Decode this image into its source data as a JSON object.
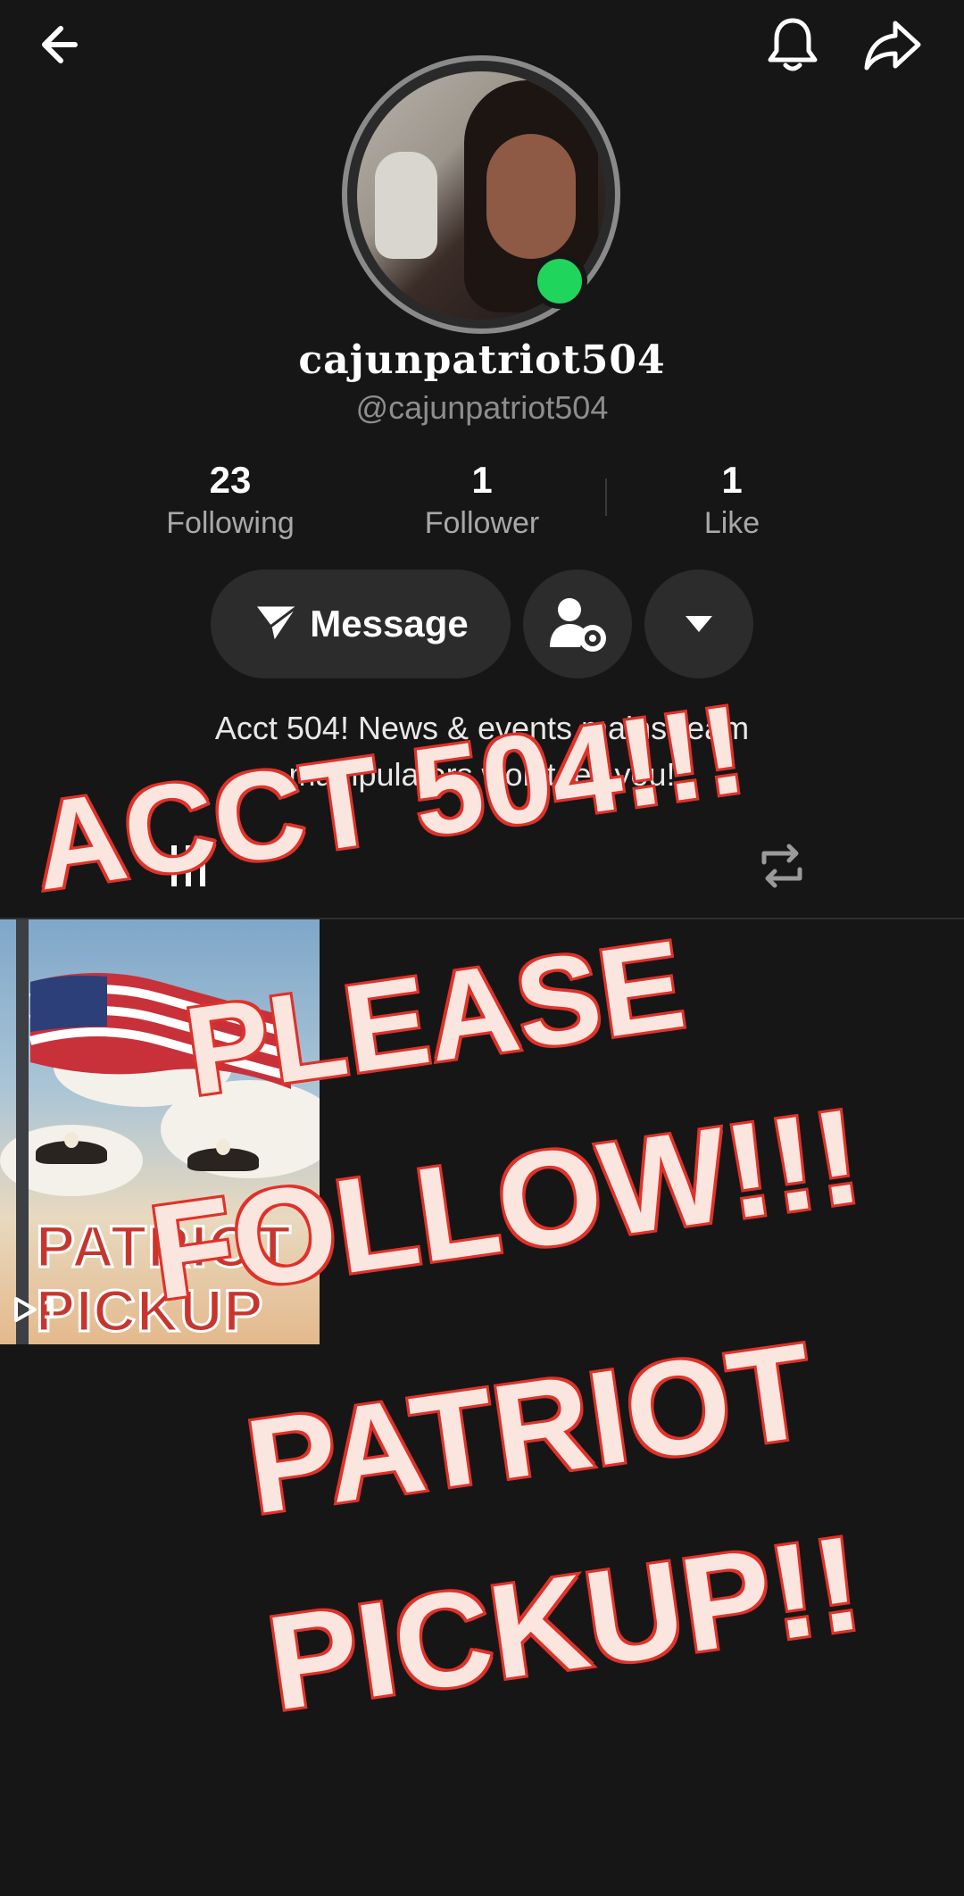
{
  "header": {
    "back_icon": "arrow-left-icon",
    "bell_icon": "bell-icon",
    "share_icon": "share-arrow-icon"
  },
  "profile": {
    "display_name": "cajunpatriot504",
    "handle": "@cajunpatriot504",
    "online_status_color": "#20d55c",
    "stats": {
      "following": {
        "value": "23",
        "label": "Following"
      },
      "followers": {
        "value": "1",
        "label": "Follower"
      },
      "likes": {
        "value": "1",
        "label": "Like"
      }
    },
    "actions": {
      "message_label": "Message",
      "message_icon": "send-plane-icon",
      "settings_icon": "person-gear-icon",
      "more_icon": "caret-down-icon"
    },
    "bio_line1": "Acct 504! News & events mainstream",
    "bio_line2": "manipulators won't tell you!"
  },
  "tabs": {
    "videos_icon": "grid-icon",
    "reposts_icon": "repost-icon"
  },
  "videos": [
    {
      "overlay_text": "PATRIOT PICKUP",
      "play_count": "1"
    }
  ],
  "overlay": {
    "line1": "ACCT 504!!!",
    "line2": "PLEASE",
    "line3": "FOLLOW!!!",
    "line4": "PATRIOT",
    "line5": "PICKUP!!",
    "fill_color": "#fbe6df",
    "stroke_color": "#e0322a"
  }
}
